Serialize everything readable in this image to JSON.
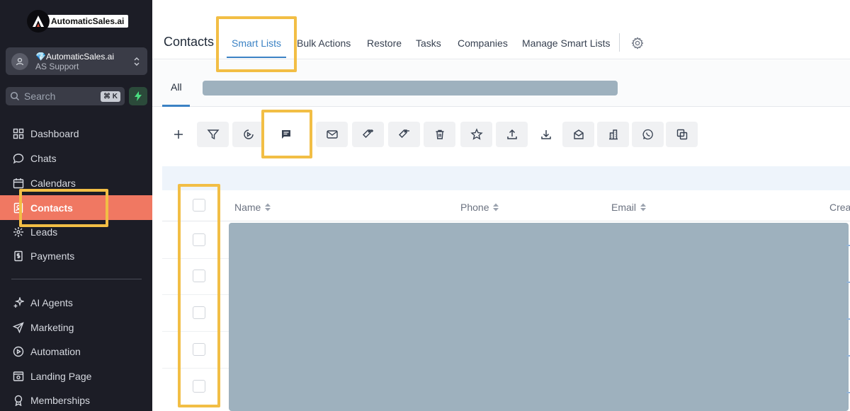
{
  "app": {
    "brand": "AutomaticSales.ai"
  },
  "account": {
    "name": "💎AutomaticSales.ai",
    "subtitle": "AS Support"
  },
  "search": {
    "label": "Search",
    "shortcut": "⌘ K"
  },
  "sidebar": {
    "items": [
      {
        "label": "Dashboard",
        "icon": "dashboard-icon"
      },
      {
        "label": "Chats",
        "icon": "chat-icon"
      },
      {
        "label": "Calendars",
        "icon": "calendar-icon"
      },
      {
        "label": "Contacts",
        "icon": "contacts-icon",
        "active": true
      },
      {
        "label": "Leads",
        "icon": "leads-icon"
      },
      {
        "label": "Payments",
        "icon": "payments-icon"
      },
      {
        "label": "AI Agents",
        "icon": "sparkle-icon"
      },
      {
        "label": "Marketing",
        "icon": "send-icon"
      },
      {
        "label": "Automation",
        "icon": "automation-icon"
      },
      {
        "label": "Landing Page",
        "icon": "landing-page-icon"
      },
      {
        "label": "Memberships",
        "icon": "membership-icon"
      }
    ]
  },
  "header": {
    "title": "Contacts",
    "tabs": [
      {
        "label": "Smart Lists",
        "active": true
      },
      {
        "label": "Bulk Actions"
      },
      {
        "label": "Restore"
      },
      {
        "label": "Tasks"
      },
      {
        "label": "Companies"
      },
      {
        "label": "Manage Smart Lists"
      }
    ]
  },
  "list_tabs": {
    "all": "All"
  },
  "toolbar": {
    "buttons": [
      "plus-icon",
      "filter-icon",
      "play-icon",
      "sms-icon",
      "email-icon",
      "tag-add-icon",
      "tag-remove-icon",
      "trash-icon",
      "star-icon",
      "upload-icon",
      "download-icon",
      "mail-open-icon",
      "building-icon",
      "whatsapp-icon",
      "merge-icon"
    ]
  },
  "table": {
    "columns": [
      "Name",
      "Phone",
      "Email",
      "Creat"
    ]
  },
  "colors": {
    "sidebar_bg": "#1c1d26",
    "active_nav": "#f07862",
    "accent_blue": "#3b82c4",
    "highlight": "#f2be45",
    "redacted": "#9eb1be"
  }
}
